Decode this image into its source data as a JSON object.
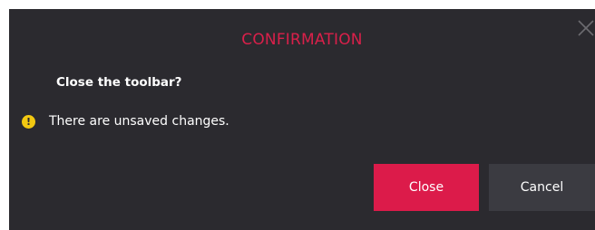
{
  "dialog": {
    "title": "CONFIRMATION",
    "question": "Close the toolbar?",
    "message": "There are unsaved changes.",
    "warning_icon_glyph": "!",
    "icons": {
      "close": "close-icon",
      "warning": "warning-icon"
    },
    "colors": {
      "background": "#2b2a2f",
      "title": "#d9204a",
      "primary_button": "#dc1b4a",
      "secondary_button": "#3b3b41",
      "warning": "#f2c811"
    },
    "buttons": {
      "close_label": "Close",
      "cancel_label": "Cancel"
    }
  }
}
